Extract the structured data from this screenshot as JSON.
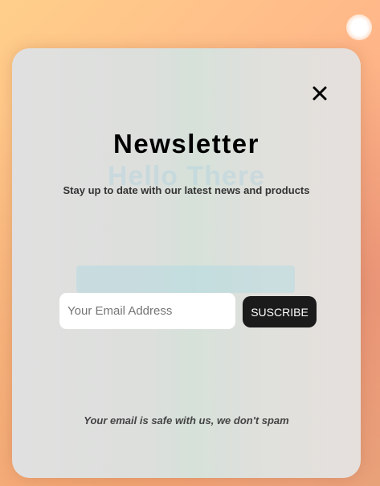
{
  "background": {
    "gradient_colors": [
      "#ffcf8a",
      "#ffb889",
      "#f8a47e",
      "#e9a47a"
    ],
    "ghost_heading": "Hello There"
  },
  "modal": {
    "close_icon": "close-icon",
    "title": "Newsletter",
    "subtitle": "Stay up to date with our latest news and products",
    "email_input": {
      "placeholder": "Your Email Address",
      "value": ""
    },
    "submit_label": "SUSCRIBE",
    "footnote": "Your email is safe with us, we don't spam",
    "colors": {
      "button_bg": "#1b1b1b",
      "button_text": "#ffffff",
      "title": "#000000"
    }
  }
}
